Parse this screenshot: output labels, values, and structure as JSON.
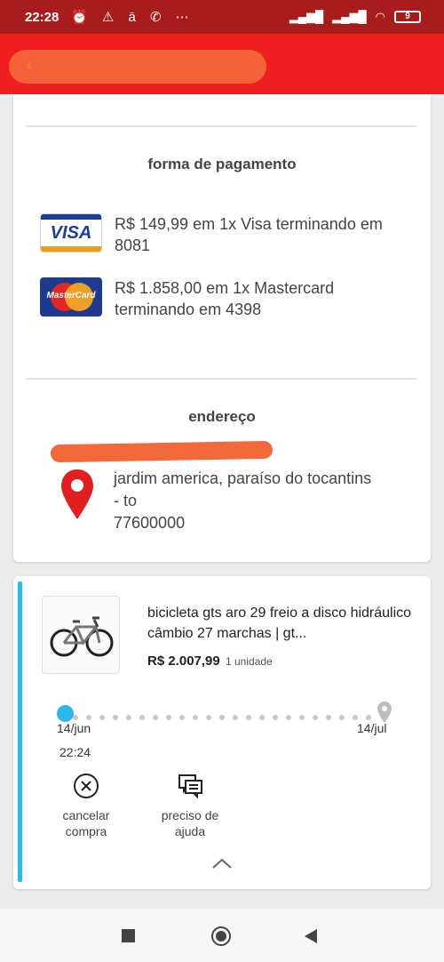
{
  "status_bar": {
    "time": "22:28",
    "left_icons": [
      "alarm-icon",
      "warning-icon",
      "a-icon",
      "whatsapp-icon",
      "more-icon"
    ],
    "left_glyphs": "⏰ ⚠ ā ✆ ⋯",
    "signal": "▂▄▆█",
    "wifi": "◠",
    "battery": "9"
  },
  "header": {
    "back_glyph": "‹"
  },
  "payment": {
    "title": "forma de pagamento",
    "methods": [
      {
        "brand": "visa",
        "brand_label": "VISA",
        "text": "R$ 149,99 em 1x Visa terminando em 8081"
      },
      {
        "brand": "mastercard",
        "brand_label": "MasterCard",
        "text": "R$ 1.858,00 em 1x Mastercard terminando em 4398"
      }
    ]
  },
  "address": {
    "title": "endereço",
    "line": "jardim america, paraíso do tocantins - to",
    "zip": "77600000"
  },
  "order": {
    "product_title": "bicicleta gts aro 29 freio a disco hidráulico câmbio 27 marchas | gt...",
    "price": "R$ 2.007,99",
    "quantity": "1 unidade",
    "timeline": {
      "start_date": "14/jun",
      "start_time": "22:24",
      "end_date": "14/jul"
    },
    "actions": [
      {
        "label_1": "cancelar",
        "label_2": "compra",
        "icon": "cancel-circle-icon"
      },
      {
        "label_1": "preciso de",
        "label_2": "ajuda",
        "icon": "chat-help-icon"
      }
    ]
  },
  "colors": {
    "status_bar": "#a81c1c",
    "header": "#f01e1e",
    "accent": "#2eb8ea",
    "pin": "#e02020"
  }
}
